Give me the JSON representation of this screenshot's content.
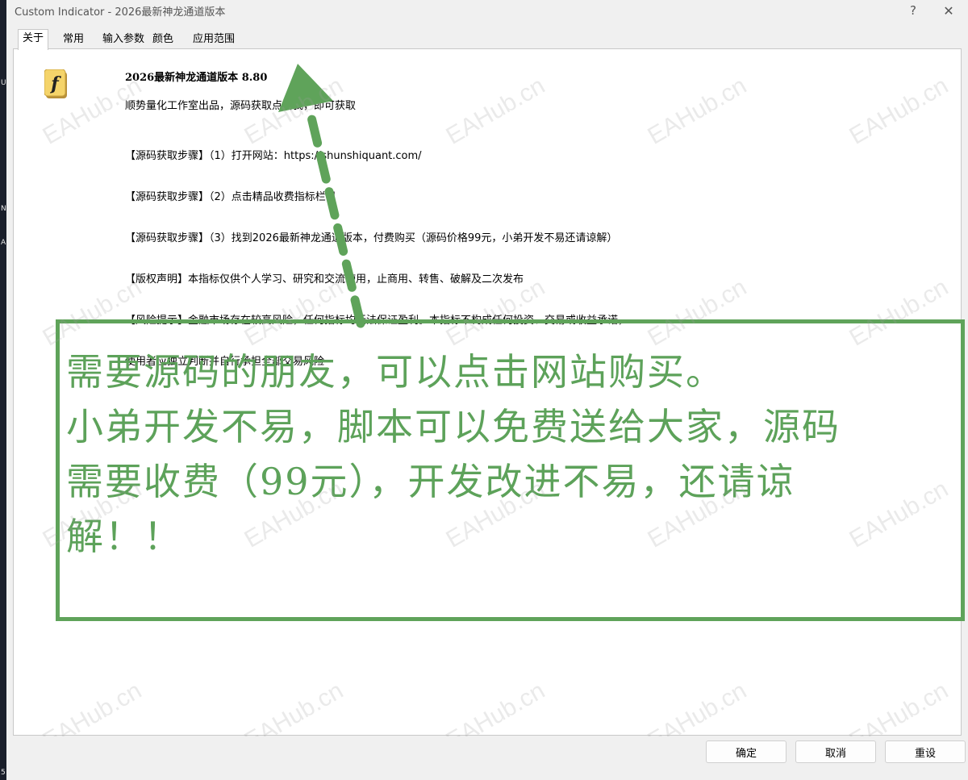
{
  "window": {
    "title": "Custom Indicator - 2026最新神龙通道版本",
    "help_glyph": "?",
    "close_glyph": "✕"
  },
  "left_strip": {
    "labels": [
      "U",
      "N",
      "A",
      "5"
    ]
  },
  "tabs": [
    {
      "label": "关于",
      "active": true
    },
    {
      "label": "常用",
      "active": false
    },
    {
      "label": "输入参数",
      "active": false
    },
    {
      "label": "颜色",
      "active": false
    },
    {
      "label": "应用范围",
      "active": false
    }
  ],
  "about": {
    "icon": "script-f-icon",
    "indicator_name": "2026最新神龙通道版本 8.80",
    "description": "顺势量化工作室出品，源码获取点击我，即可获取",
    "lines": [
      "【源码获取步骤】（1）打开网站：https://shunshiquant.com/",
      "【源码获取步骤】（2）点击精品收费指标栏目",
      "【源码获取步骤】（3）找到2026最新神龙通道版本，付费购买（源码价格99元，小弟开发不易还请谅解）",
      "【版权声明】本指标仅供个人学习、研究和交流使用，止商用、转售、破解及二次发布",
      "【风险提示】金融市场存在较高风险，任何指标均无法保证盈利。本指标不构成任何投资、交易或收益承诺，",
      "使用者应独立判断并自行承担全部交易风险"
    ]
  },
  "notice": {
    "color": "#5fa35a",
    "lines": [
      "需要源码的朋友，可以点击网站购买。",
      "小弟开发不易，脚本可以免费送给大家，源码",
      "需要收费（99元），开发改进不易，还请谅",
      "解！！"
    ]
  },
  "watermark": {
    "text": "EAHub.cn"
  },
  "buttons": {
    "ok": "确定",
    "cancel": "取消",
    "reset": "重设"
  }
}
